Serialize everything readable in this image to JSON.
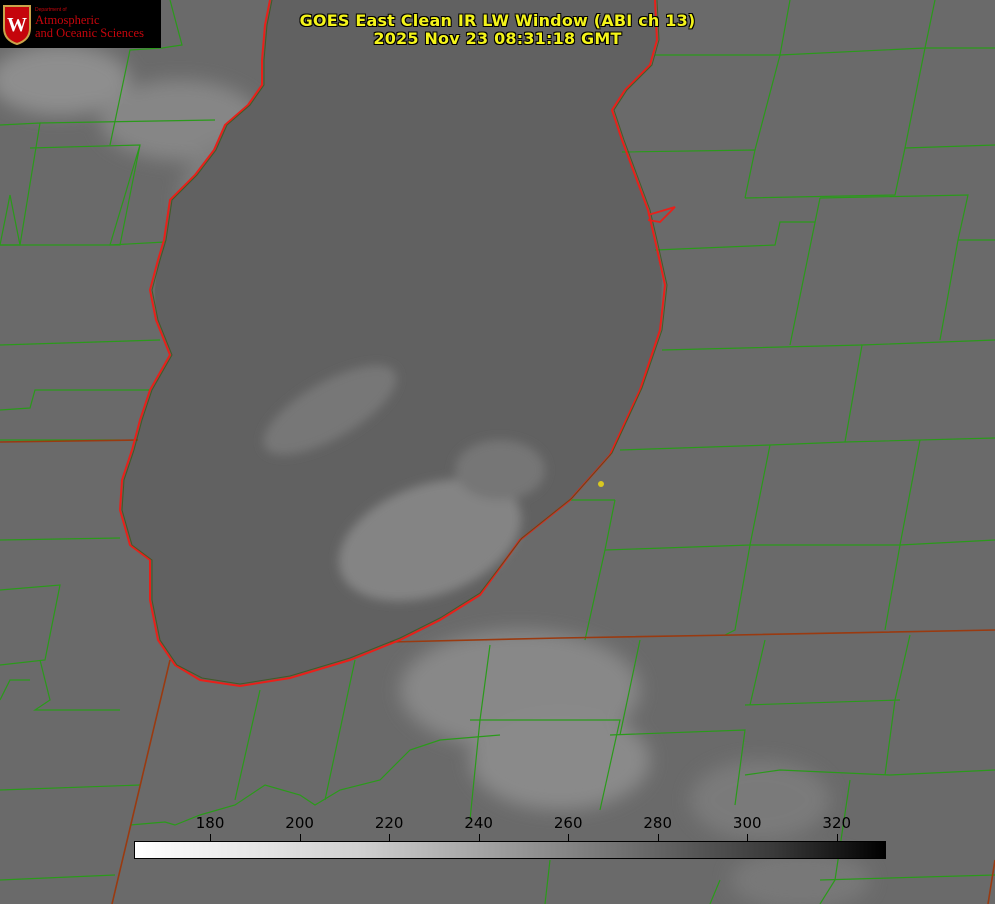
{
  "title": {
    "line1": "GOES East Clean IR LW Window (ABI ch 13)",
    "line2": "2025 Nov 23 08:31:18 GMT"
  },
  "logo": {
    "crest_letter": "W",
    "dept": "Department of",
    "line1": "Atmospheric",
    "line2": "and Oceanic Sciences"
  },
  "colorbar": {
    "ticks": [
      "180",
      "200",
      "220",
      "240",
      "260",
      "280",
      "300",
      "320"
    ],
    "min": 163,
    "max": 331,
    "colors": {
      "low": "#ffffff",
      "high": "#000000"
    }
  },
  "map": {
    "shoreline_color": "#e8201a",
    "county_color": "#2a9a1a",
    "state_border_color": "#9a3a10",
    "marker_color": "#d8c820"
  }
}
